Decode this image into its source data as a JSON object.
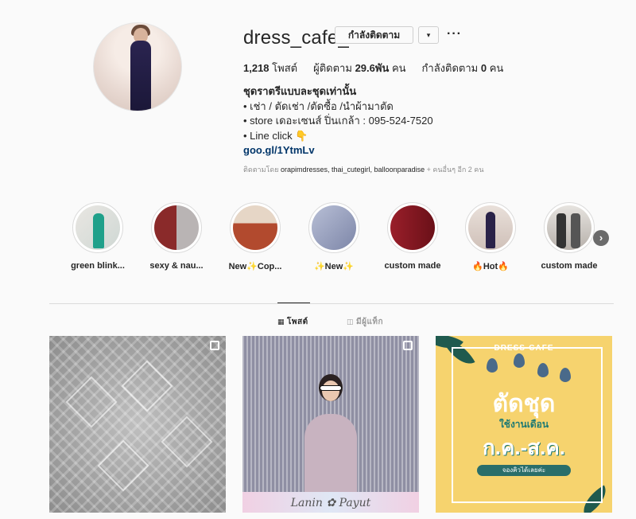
{
  "profile": {
    "username": "dress_cafe_",
    "follow_button": "กำลังติดตาม",
    "dropdown_icon": "▾",
    "more_icon": "···"
  },
  "stats": {
    "posts": "1,218",
    "posts_label": "โพสต์",
    "followers_label": "ผู้ติดตาม",
    "followers": "29.6พัน",
    "followers_unit": "คน",
    "following_label": "กำลังติดตาม",
    "following": "0",
    "following_unit": "คน"
  },
  "bio": {
    "name": "ชุดราตรีแบบละชุดเท่านั้น",
    "line1": "• เช่า / ตัดเช่า /ตัดซื้อ /นำผ้ามาตัด",
    "line2": "• store เดอะเซนส์ ปิ่นเกล้า : 095-524-7520",
    "line3": "• Line click 👇",
    "link": "goo.gl/1YtmLv",
    "followed_by_prefix": "ติดตามโดย",
    "followed_by_names": "orapimdresses, thai_cutegirl, balloonparadise",
    "followed_by_suffix": "+ คนอื่นๆ อีก 2 คน"
  },
  "highlights": [
    {
      "label": "green blink..."
    },
    {
      "label": "sexy & nau..."
    },
    {
      "label": "New✨Cop..."
    },
    {
      "label": "✨New✨"
    },
    {
      "label": "custom made"
    },
    {
      "label": "🔥Hot🔥"
    },
    {
      "label": "custom made"
    }
  ],
  "highlights_next_icon": "›",
  "tabs": {
    "posts_icon": "▦",
    "posts": "โพสต์",
    "tagged_icon": "◫",
    "tagged": "มีผู้แท็ก"
  },
  "posts": {
    "post2_caption": "Lanin ✿ Payut",
    "post3_brand": "DRESS-CAFE",
    "post3_title": "ตัดชุด",
    "post3_sub": "ใช้งานเดือน",
    "post3_months": "ก.ค.-ส.ค.",
    "post3_foot": "จองคิวได้เลยค่ะ"
  },
  "colors": {
    "link": "#003569",
    "post3_bg": "#f6d36e",
    "post3_accent": "#1f7a73"
  }
}
